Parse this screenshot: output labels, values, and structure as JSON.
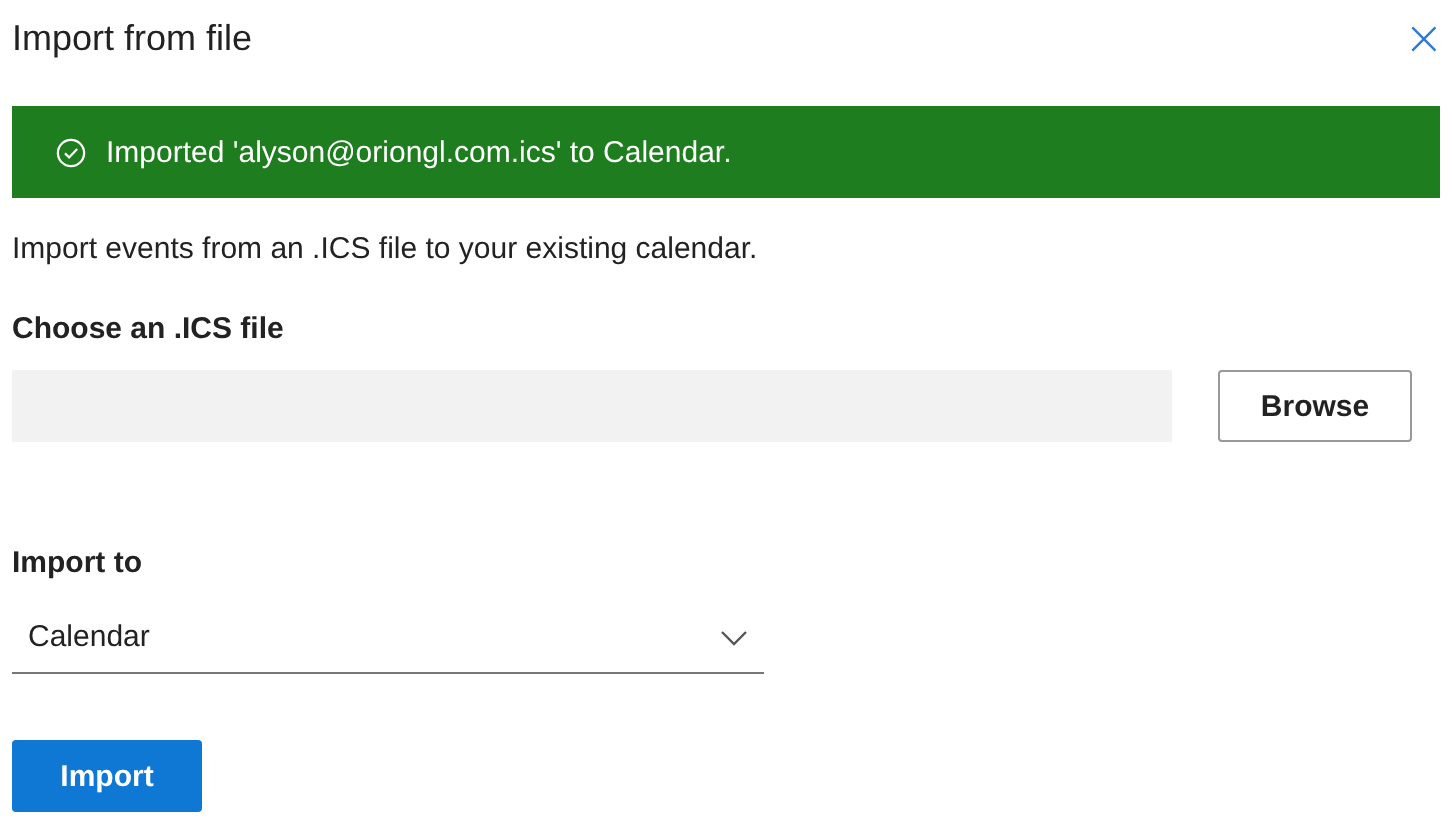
{
  "dialog": {
    "title": "Import from file",
    "close": "×"
  },
  "banner": {
    "kind": "success",
    "message": "Imported 'alyson@oriongl.com.ics' to Calendar."
  },
  "description": "Import events from an .ICS file to your existing calendar.",
  "file_picker": {
    "label": "Choose an .ICS file",
    "button": "Browse"
  },
  "import_to": {
    "label": "Import to",
    "value": "Calendar"
  },
  "buttons": [
    "Import"
  ]
}
